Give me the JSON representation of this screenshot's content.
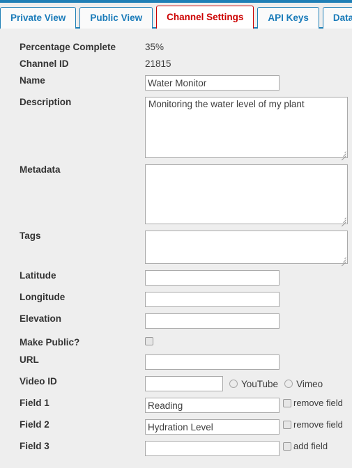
{
  "tabs": [
    {
      "label": "Private View",
      "active": false
    },
    {
      "label": "Public View",
      "active": false
    },
    {
      "label": "Channel Settings",
      "active": true
    },
    {
      "label": "API Keys",
      "active": false
    },
    {
      "label": "Data",
      "active": false
    }
  ],
  "colors": {
    "accent_blue": "#1f7fb6",
    "tab_link_blue": "#1a7bb9",
    "active_tab_red": "#cc0000",
    "page_background": "#eeeeee",
    "input_border": "#aaaaaa"
  },
  "form": {
    "percentage_complete": {
      "label": "Percentage Complete",
      "value": "35%"
    },
    "channel_id": {
      "label": "Channel ID",
      "value": "21815"
    },
    "name": {
      "label": "Name",
      "value": "Water Monitor",
      "placeholder": ""
    },
    "description": {
      "label": "Description",
      "value": "Monitoring the water level of my plant",
      "placeholder": ""
    },
    "metadata": {
      "label": "Metadata",
      "value": "",
      "placeholder": ""
    },
    "tags": {
      "label": "Tags",
      "value": "",
      "placeholder": ""
    },
    "latitude": {
      "label": "Latitude",
      "value": "",
      "placeholder": ""
    },
    "longitude": {
      "label": "Longitude",
      "value": "",
      "placeholder": ""
    },
    "elevation": {
      "label": "Elevation",
      "value": "",
      "placeholder": ""
    },
    "make_public": {
      "label": "Make Public?",
      "checked": false
    },
    "url": {
      "label": "URL",
      "value": "",
      "placeholder": ""
    },
    "video_id": {
      "label": "Video ID",
      "value": "",
      "placeholder": ""
    },
    "video_sources": [
      {
        "label": "YouTube",
        "selected": false
      },
      {
        "label": "Vimeo",
        "selected": false
      }
    ],
    "fields": [
      {
        "label": "Field 1",
        "value": "Reading",
        "action_label": "remove field",
        "checked": false
      },
      {
        "label": "Field 2",
        "value": "Hydration Level",
        "action_label": "remove field",
        "checked": false
      },
      {
        "label": "Field 3",
        "value": "",
        "action_label": "add field",
        "checked": false
      }
    ]
  }
}
